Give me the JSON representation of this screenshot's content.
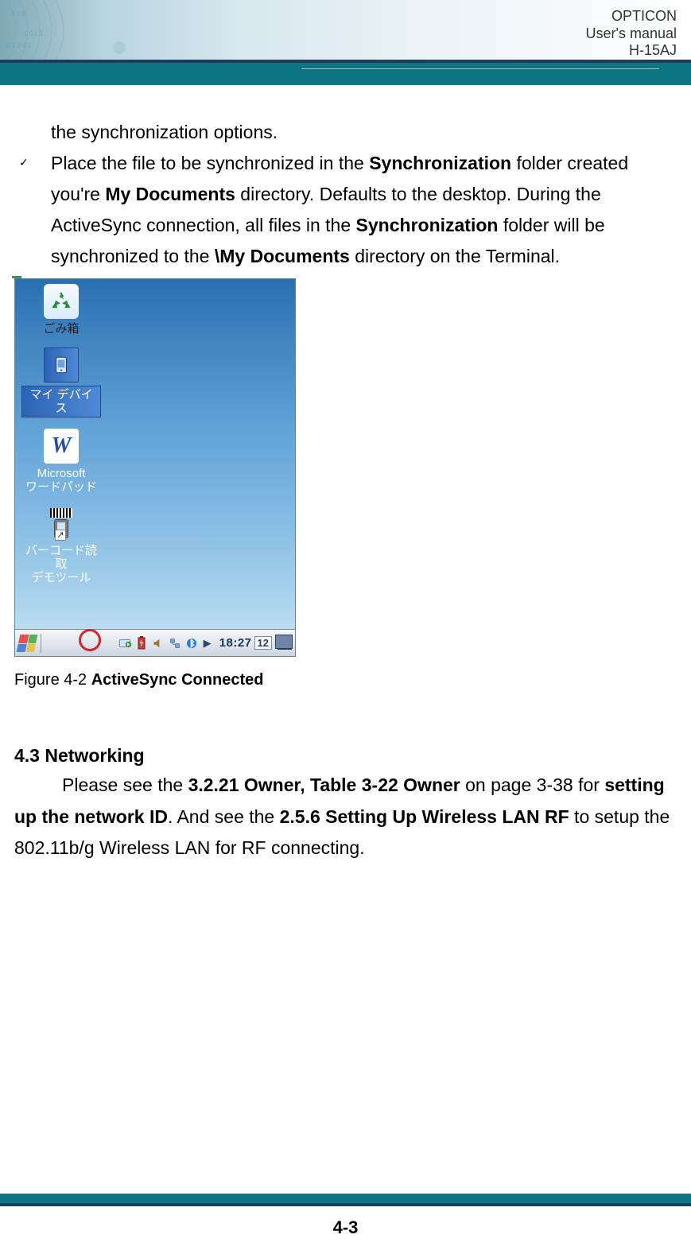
{
  "header": {
    "brand": "OPTICON",
    "subtitle": "User's manual",
    "model": "H-15AJ"
  },
  "content": {
    "sync_options_line": "the synchronization options.",
    "bullet": {
      "t1": "Place the file to be synchronized in the ",
      "b1": "Synchronization",
      "t2": " folder created you're ",
      "b2": "My Documents",
      "t3": " directory. Defaults to the desktop. During the ActiveSync connection, all files in the ",
      "b3": "Synchronization",
      "t4": " folder will be synchronized to the ",
      "b4": "\\My Documents",
      "t5": " directory on the Terminal."
    }
  },
  "screenshot": {
    "desktop_icons": {
      "recycle": "ごみ箱",
      "mydevice": "マイ デバイス",
      "wordpad_l1": "Microsoft",
      "wordpad_l2": "ワードパッド",
      "barcode_l1": "バーコード読取",
      "barcode_l2": "デモツール"
    },
    "taskbar": {
      "clock": "18:27",
      "date": "12"
    }
  },
  "figure_caption": {
    "prefix": "Figure 4-2 ",
    "bold": "ActiveSync Connected"
  },
  "networking": {
    "heading": "4.3 Networking",
    "t1": "Please see the ",
    "b1": "3.2.21 Owner, Table 3-22 Owner",
    "t2": " on page 3-38 for ",
    "b2": "setting up the network ID",
    "t3": ". And see the ",
    "b3": "2.5.6 Setting Up Wireless LAN RF",
    "t4": " to setup the 802.11b/g Wireless LAN for RF connecting."
  },
  "page_number": "4-3"
}
